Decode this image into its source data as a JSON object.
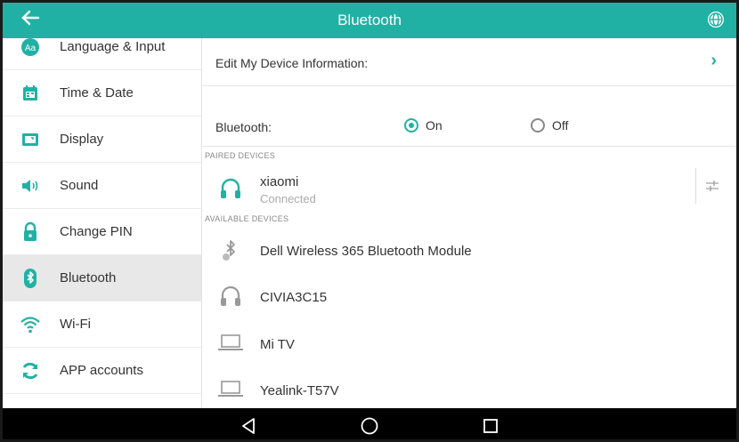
{
  "titlebar": {
    "title": "Bluetooth",
    "back_icon": "back-arrow-icon",
    "globe_icon": "globe-icon",
    "accent": "#21b1a4"
  },
  "sidebar": {
    "items": [
      {
        "label": "Language & Input",
        "icon": "language-icon"
      },
      {
        "label": "Time & Date",
        "icon": "calendar-icon"
      },
      {
        "label": "Display",
        "icon": "display-icon"
      },
      {
        "label": "Sound",
        "icon": "speaker-icon"
      },
      {
        "label": "Change PIN",
        "icon": "lock-icon"
      },
      {
        "label": "Bluetooth",
        "icon": "bluetooth-icon",
        "active": true
      },
      {
        "label": "Wi-Fi",
        "icon": "wifi-icon"
      },
      {
        "label": "APP accounts",
        "icon": "sync-icon"
      }
    ]
  },
  "main": {
    "edit_device": "Edit My Device Information:",
    "bluetooth_label": "Bluetooth:",
    "on_label": "On",
    "off_label": "Off",
    "bluetooth_state": "On",
    "paired_header": "PAIRED DEVICES",
    "available_header": "AVAILABLE DEVICES",
    "paired": [
      {
        "name": "xiaomi",
        "status": "Connected",
        "icon": "headset-icon"
      }
    ],
    "available": [
      {
        "name": "Dell Wireless 365 Bluetooth Module",
        "icon": "bluetooth-device-icon"
      },
      {
        "name": "CIVIA3C15",
        "icon": "headset-icon"
      },
      {
        "name": "Mi TV",
        "icon": "laptop-icon"
      },
      {
        "name": "Yealink-T57V",
        "icon": "laptop-icon"
      }
    ]
  },
  "navbar": {
    "back": "nav-back-icon",
    "home": "nav-home-icon",
    "recents": "nav-recents-icon"
  }
}
